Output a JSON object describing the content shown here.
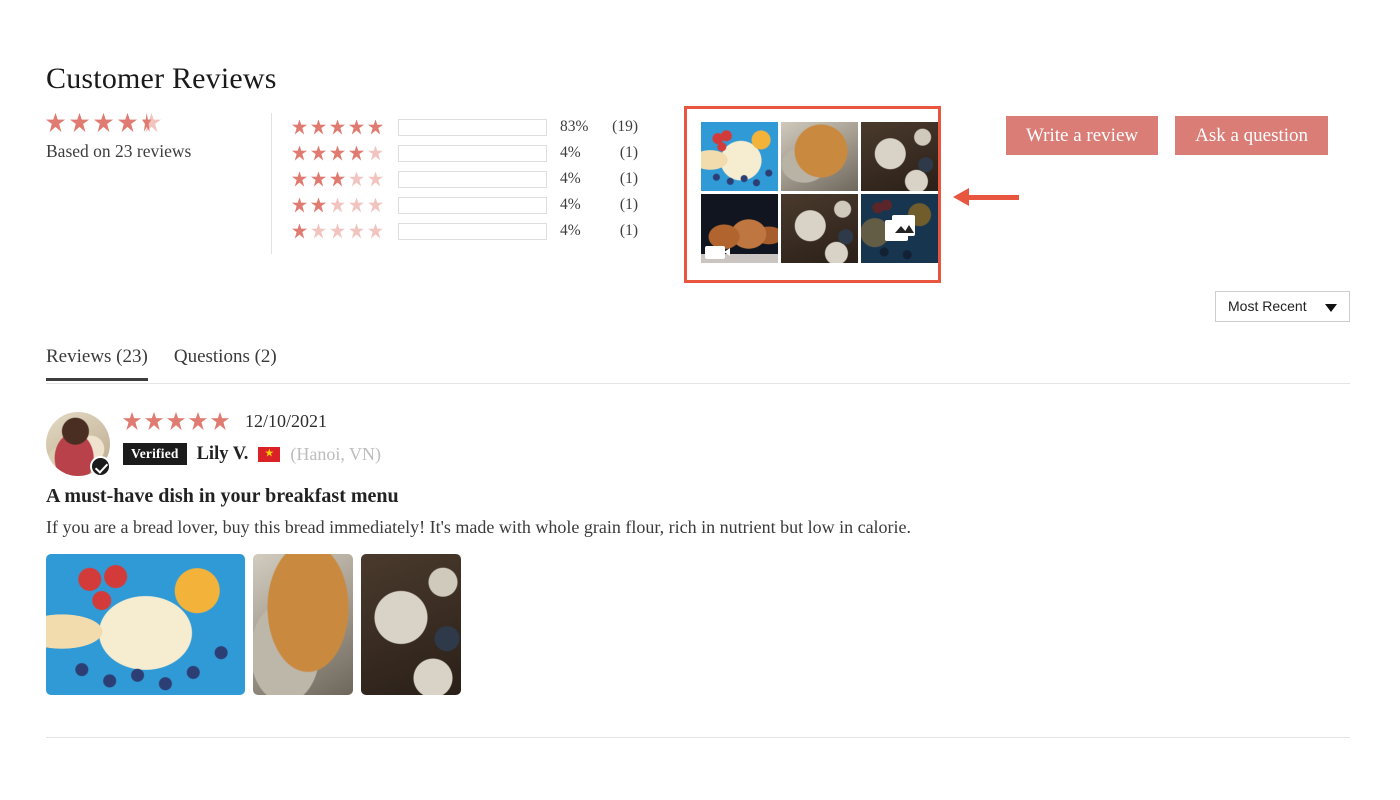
{
  "heading": "Customer Reviews",
  "summary": {
    "rating": 4.5,
    "stars_filled": 4,
    "has_half_star": true,
    "based_on_text": "Based on 23 reviews",
    "total_reviews": 23
  },
  "histogram": {
    "rows": [
      {
        "stars": 5,
        "percent": "83%",
        "count": "(19)",
        "fill_width": 83
      },
      {
        "stars": 4,
        "percent": "4%",
        "count": "(1)",
        "fill_width": 4
      },
      {
        "stars": 3,
        "percent": "4%",
        "count": "(1)",
        "fill_width": 4
      },
      {
        "stars": 2,
        "percent": "4%",
        "count": "(1)",
        "fill_width": 4
      },
      {
        "stars": 1,
        "percent": "4%",
        "count": "(1)",
        "fill_width": 4
      }
    ]
  },
  "gallery": {
    "highlighted": true,
    "highlight_color": "#e8563f",
    "thumbnails": [
      {
        "name": "toast-face-blue-board",
        "kind": "photo"
      },
      {
        "name": "braided-bread-loaf",
        "kind": "photo"
      },
      {
        "name": "breakfast-bowl-dark-wood",
        "kind": "photo"
      },
      {
        "name": "bread-video-thumbnail",
        "kind": "video"
      },
      {
        "name": "breakfast-bowl-dark-wood-2",
        "kind": "photo"
      },
      {
        "name": "more-media-overlay",
        "kind": "more"
      }
    ]
  },
  "annotation": {
    "arrow_direction": "left",
    "arrow_color": "#e8563f"
  },
  "actions": {
    "write_review": "Write a review",
    "ask_question": "Ask a question",
    "button_color": "#da7d76"
  },
  "sort": {
    "selected": "Most Recent"
  },
  "tabs": [
    {
      "label": "Reviews (23)",
      "active": true
    },
    {
      "label": "Questions (2)",
      "active": false
    }
  ],
  "review": {
    "stars": 5,
    "date": "12/10/2021",
    "verified_badge": "Verified",
    "reviewer_name": "Lily V.",
    "flag_country": "VN",
    "location": "(Hanoi, VN)",
    "title": "A must-have dish in your breakfast menu",
    "body": "If you are a bread lover, buy this bread immediately! It's made with whole grain flour, rich in nutrient but low in calorie.",
    "photos": [
      {
        "name": "review-photo-toast-face"
      },
      {
        "name": "review-photo-braided-bread"
      },
      {
        "name": "review-photo-breakfast-bowl"
      }
    ]
  },
  "colors": {
    "star_filled": "#df7b71",
    "star_empty": "#f2c4bf",
    "bar_fill": "#f3c73f",
    "accent_red": "#e8563f"
  }
}
